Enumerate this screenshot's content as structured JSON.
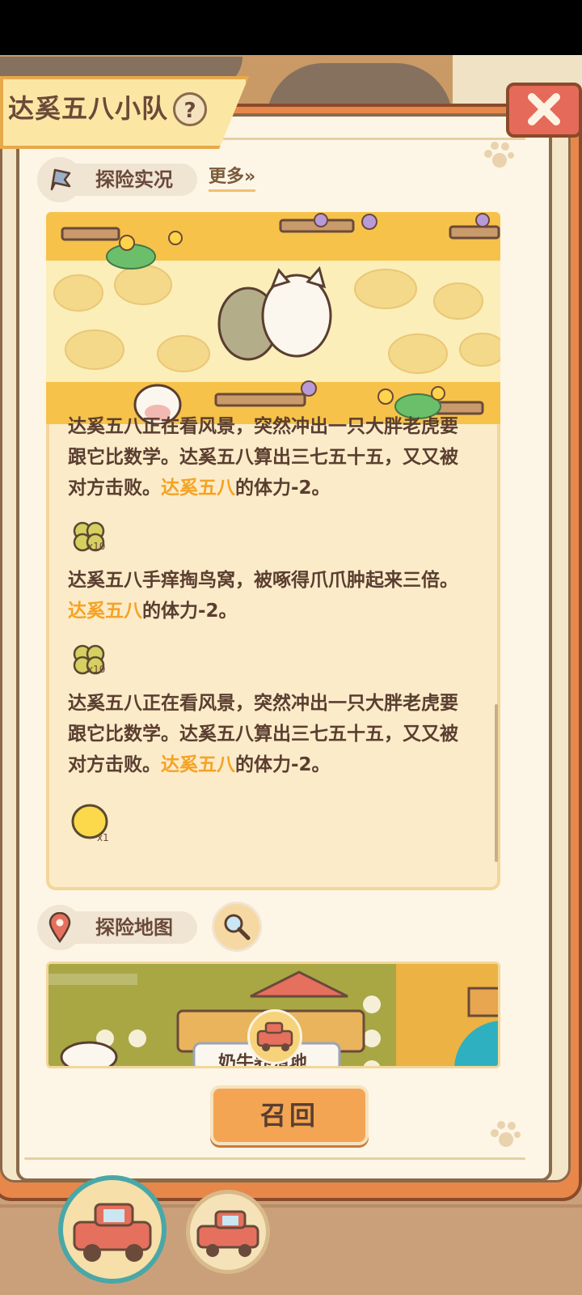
{
  "team": {
    "title": "达奚五八小队",
    "help_label": "?"
  },
  "close": {
    "icon": "close-x-icon"
  },
  "report": {
    "title": "探险实况",
    "more_label": "更多»",
    "entries": [
      {
        "pre": "达奚五八正在看风景，突然冲出一只大胖老虎要跟它比数学。达奚五八算出三七五十五，又又被对方击败。",
        "name": "达奚五八",
        "post": "的体力-2。",
        "reward_icon": "clover-icon",
        "reward_count": "x10"
      },
      {
        "pre": "达奚五八手痒掏鸟窝，被啄得爪爪肿起来三倍。",
        "name": "达奚五八",
        "post": "的体力-2。",
        "reward_icon": "clover-icon",
        "reward_count": "x10"
      },
      {
        "pre": "达奚五八正在看风景，突然冲出一只大胖老虎要跟它比数学。达奚五八算出三七五十五，又又被对方击败。",
        "name": "达奚五八",
        "post": "的体力-2。",
        "reward_icon": "lemon-icon",
        "reward_count": "x1"
      }
    ]
  },
  "map": {
    "title": "探险地图",
    "location_sign": "奶牛养殖地"
  },
  "recall_label": "召回",
  "colors": {
    "highlight": "#f4a324",
    "accent": "#e8874a",
    "text": "#5a3e30"
  }
}
